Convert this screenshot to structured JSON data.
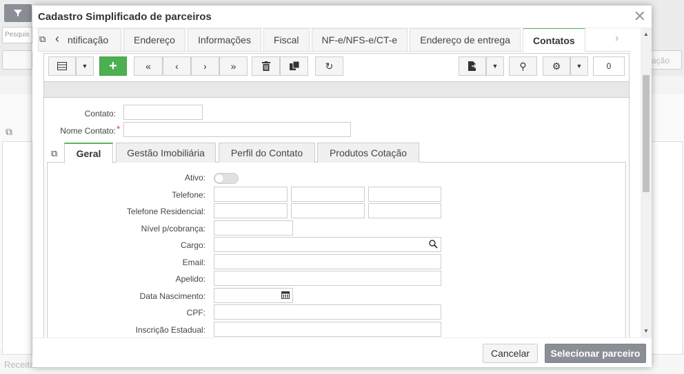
{
  "background": {
    "search_placeholder": "Pesquis",
    "right_button": "ação",
    "footer_text": "Receita:"
  },
  "modal": {
    "title": "Cadastro Simplificado de parceiros",
    "outer_tabs": [
      "ntificação",
      "Endereço",
      "Informações",
      "Fiscal",
      "NF-e/NFS-e/CT-e",
      "Endereço de entrega",
      "Contatos"
    ],
    "active_tab": "Contatos",
    "toolbar": {
      "record_count": "0"
    },
    "contact": {
      "contato_label": "Contato:",
      "contato_value": "",
      "nome_label": "Nome Contato:",
      "nome_value": "",
      "required_mark": "*"
    },
    "inner_tabs": [
      "Geral",
      "Gestão Imobiliária",
      "Perfil do Contato",
      "Produtos Cotação"
    ],
    "form": {
      "ativo": "Ativo:",
      "telefone": "Telefone:",
      "telefone_res": "Telefone Residencial:",
      "nivel": "Nível p/cobrança:",
      "cargo": "Cargo:",
      "email": "Email:",
      "apelido": "Apelido:",
      "nascimento": "Data Nascimento:",
      "cpf": "CPF:",
      "inscricao": "Inscrição Estadual:",
      "ativo_on": false
    },
    "footer": {
      "cancel": "Cancelar",
      "select": "Selecionar parceiro"
    }
  },
  "colors": {
    "accent_green": "#4caf50",
    "primary_grey": "#8a8f96",
    "required_red": "#d9534f"
  }
}
